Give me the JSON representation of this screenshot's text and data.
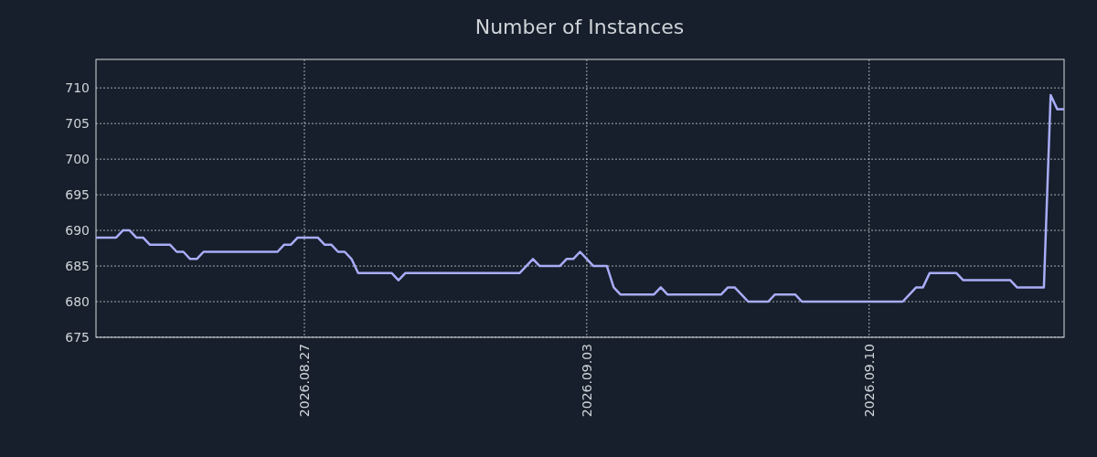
{
  "chart_data": {
    "type": "line",
    "title": "Number of Instances",
    "categories": [
      null,
      null,
      null,
      null,
      null,
      null,
      null,
      null,
      null,
      null,
      null,
      null,
      null,
      null,
      null,
      null,
      null,
      null,
      null,
      null,
      null,
      null,
      null,
      null,
      null,
      null,
      null,
      null,
      null,
      null,
      null,
      "2026.08.27",
      null,
      null,
      null,
      null,
      null,
      null,
      null,
      null,
      null,
      null,
      null,
      null,
      null,
      null,
      null,
      null,
      null,
      null,
      null,
      null,
      null,
      null,
      null,
      null,
      null,
      null,
      null,
      null,
      null,
      null,
      null,
      null,
      null,
      null,
      null,
      null,
      null,
      null,
      null,
      null,
      null,
      "2026.09.03",
      null,
      null,
      null,
      null,
      null,
      null,
      null,
      null,
      null,
      null,
      null,
      null,
      null,
      null,
      null,
      null,
      null,
      null,
      null,
      null,
      null,
      null,
      null,
      null,
      null,
      null,
      null,
      null,
      null,
      null,
      null,
      null,
      null,
      null,
      null,
      null,
      null,
      null,
      null,
      null,
      null,
      "2026.09.10",
      null,
      null,
      null,
      null,
      null,
      null,
      null,
      null,
      null,
      null,
      null,
      null,
      null,
      null,
      null,
      null,
      null,
      null,
      null,
      null,
      null,
      null,
      null,
      null,
      null,
      null,
      null,
      null,
      null
    ],
    "series": [
      {
        "color": "#a9acf7",
        "values": [
          689,
          689,
          689,
          689,
          690,
          690,
          689,
          689,
          688,
          688,
          688,
          688,
          687,
          687,
          686,
          686,
          687,
          687,
          687,
          687,
          687,
          687,
          687,
          687,
          687,
          687,
          687,
          687,
          688,
          688,
          689,
          689,
          689,
          689,
          688,
          688,
          687,
          687,
          686,
          684,
          684,
          684,
          684,
          684,
          684,
          683,
          684,
          684,
          684,
          684,
          684,
          684,
          684,
          684,
          684,
          684,
          684,
          684,
          684,
          684,
          684,
          684,
          684,
          684,
          685,
          686,
          685,
          685,
          685,
          685,
          686,
          686,
          687,
          686,
          685,
          685,
          685,
          682,
          681,
          681,
          681,
          681,
          681,
          681,
          682,
          681,
          681,
          681,
          681,
          681,
          681,
          681,
          681,
          681,
          682,
          682,
          681,
          680,
          680,
          680,
          680,
          681,
          681,
          681,
          681,
          680,
          680,
          680,
          680,
          680,
          680,
          680,
          680,
          680,
          680,
          680,
          680,
          680,
          680,
          680,
          680,
          681,
          682,
          682,
          684,
          684,
          684,
          684,
          684,
          683,
          683,
          683,
          683,
          683,
          683,
          683,
          683,
          682,
          682,
          682,
          682,
          682,
          709,
          707,
          707
        ]
      }
    ],
    "grid": true,
    "ylim": [
      675,
      714
    ],
    "yticks": [
      675,
      680,
      685,
      690,
      695,
      700,
      705,
      710
    ]
  }
}
